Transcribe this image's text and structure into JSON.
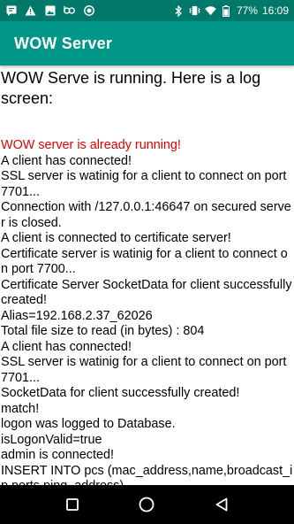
{
  "status_bar": {
    "left_icons": [
      "message-icon",
      "warning-icon",
      "image-icon",
      "bo-app-icon",
      "record-icon"
    ],
    "right_icons": [
      "bluetooth-icon",
      "vibrate-icon",
      "wifi-icon",
      "battery-icon"
    ],
    "battery_percent": "77%",
    "time": "16:09"
  },
  "app_bar": {
    "title": "WOW Server",
    "color": "#009688"
  },
  "content": {
    "heading": "WOW Serve is running. Here is a log screen:",
    "log_lines": [
      {
        "text": "WOW server is already running!",
        "type": "error"
      },
      {
        "text": "A client has connected!",
        "type": "info"
      },
      {
        "text": "SSL server is watinig for a client to connect on port 7701...",
        "type": "info"
      },
      {
        "text": "Connection with /127.0.0.1:46647 on secured server is closed.",
        "type": "info"
      },
      {
        "text": "A client is connected to certificate server!",
        "type": "info"
      },
      {
        "text": "Certificate server is watinig for a client to connect on port 7700...",
        "type": "info"
      },
      {
        "text": "Certificate Server SocketData for client successfully created!",
        "type": "info"
      },
      {
        "text": "Alias=192.168.2.37_62026",
        "type": "info"
      },
      {
        "text": "Total file size to read (in bytes) : 804",
        "type": "info"
      },
      {
        "text": "A client has connected!",
        "type": "info"
      },
      {
        "text": "SSL server is watinig for a client to connect on port 7701...",
        "type": "info"
      },
      {
        "text": "SocketData for client successfully created!",
        "type": "info"
      },
      {
        "text": "match!",
        "type": "info"
      },
      {
        "text": "logon was logged to Database.",
        "type": "info"
      },
      {
        "text": "isLogonValid=true",
        "type": "info"
      },
      {
        "text": "admin is connected!",
        "type": "info"
      },
      {
        "text": "INSERT INTO pcs (mac_address,name,broadcast_ip,ports,ping_address)",
        "type": "info"
      }
    ],
    "error_color": "#e00000"
  },
  "nav_bar": {
    "buttons": [
      "recents-square-icon",
      "home-circle-icon",
      "back-triangle-icon"
    ]
  }
}
